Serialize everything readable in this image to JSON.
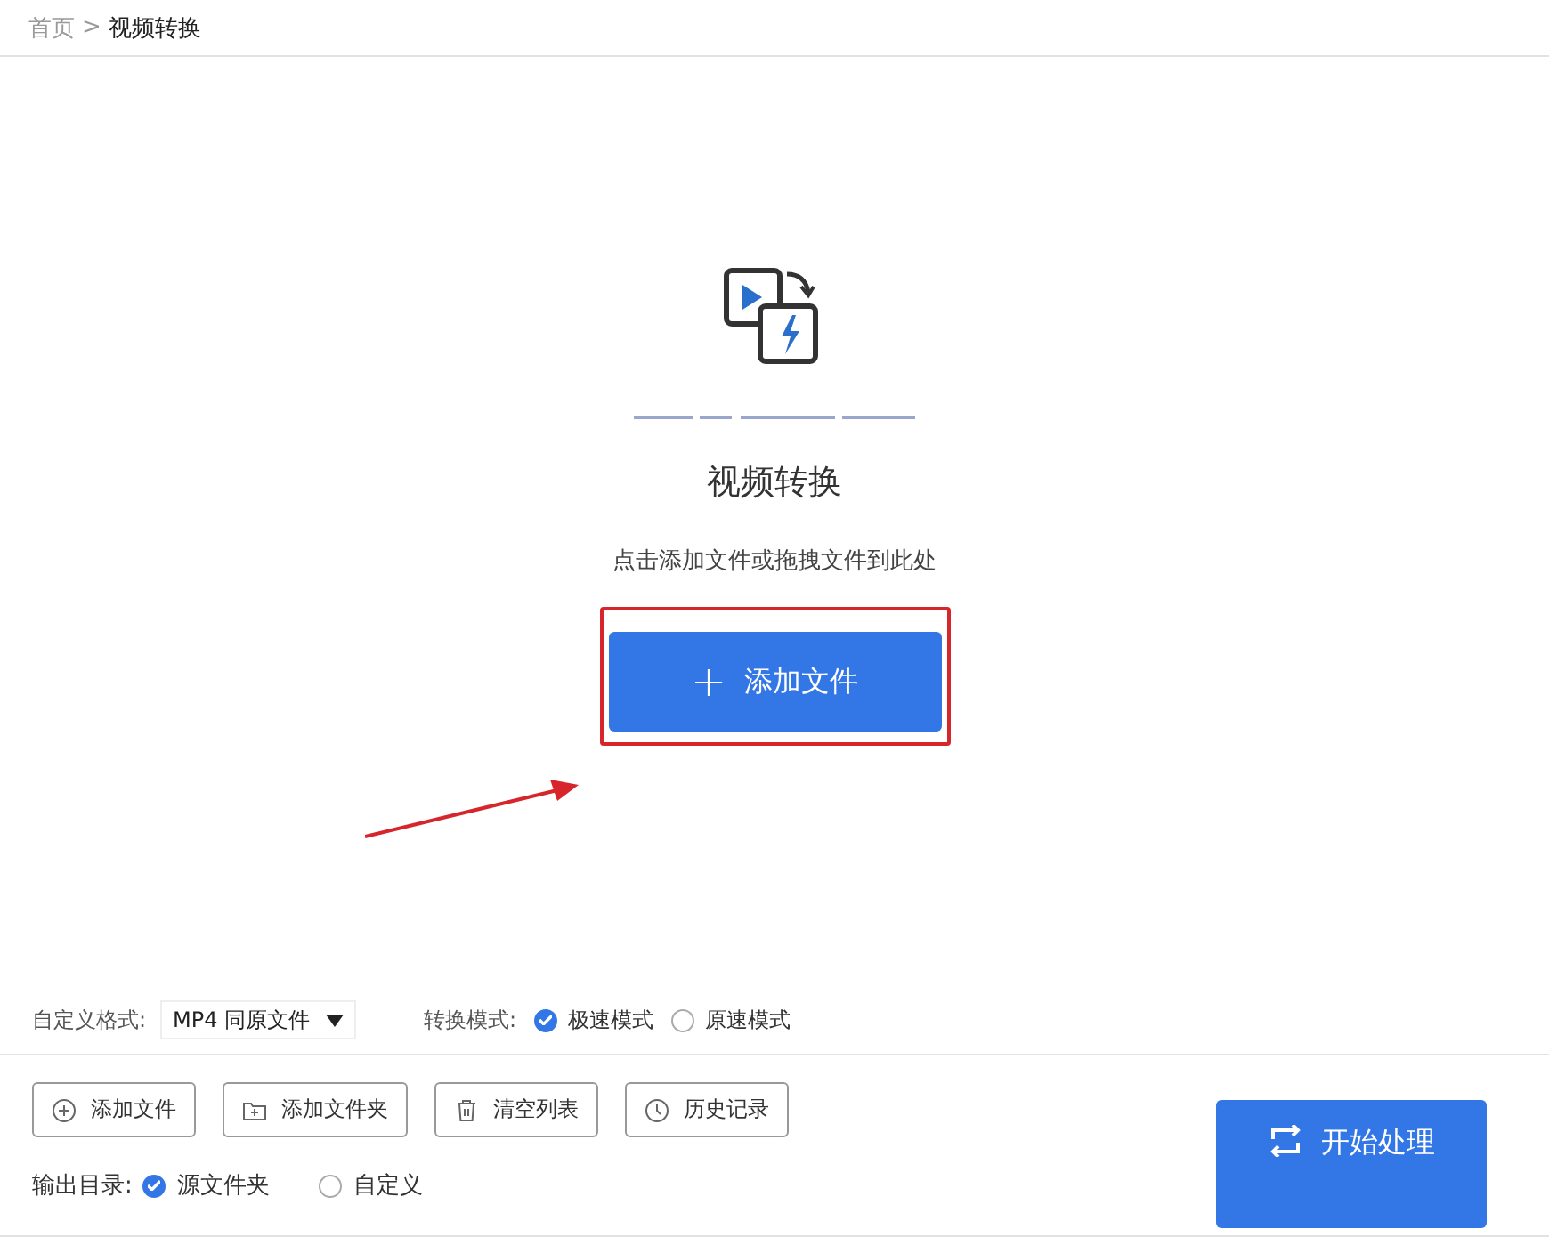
{
  "breadcrumb": {
    "home": "首页",
    "separator": ">",
    "current": "视频转换"
  },
  "dropzone": {
    "title": "视频转换",
    "hint": "点击添加文件或拖拽文件到此处",
    "add_button": "添加文件",
    "add_icon": "+",
    "highlighted": true
  },
  "format": {
    "label": "自定义格式:",
    "value": "MP4 同原文件"
  },
  "mode": {
    "label": "转换模式:",
    "options": [
      {
        "label": "极速模式",
        "selected": true
      },
      {
        "label": "原速模式",
        "selected": false
      }
    ]
  },
  "toolbar": [
    {
      "kind": "add-file",
      "label": "添加文件"
    },
    {
      "kind": "add-folder",
      "label": "添加文件夹"
    },
    {
      "kind": "clear",
      "label": "清空列表"
    },
    {
      "kind": "history",
      "label": "历史记录"
    }
  ],
  "output": {
    "label": "输出目录:",
    "options": [
      {
        "label": "源文件夹",
        "selected": true
      },
      {
        "label": "自定义",
        "selected": false
      }
    ]
  },
  "start_button": "开始处理"
}
